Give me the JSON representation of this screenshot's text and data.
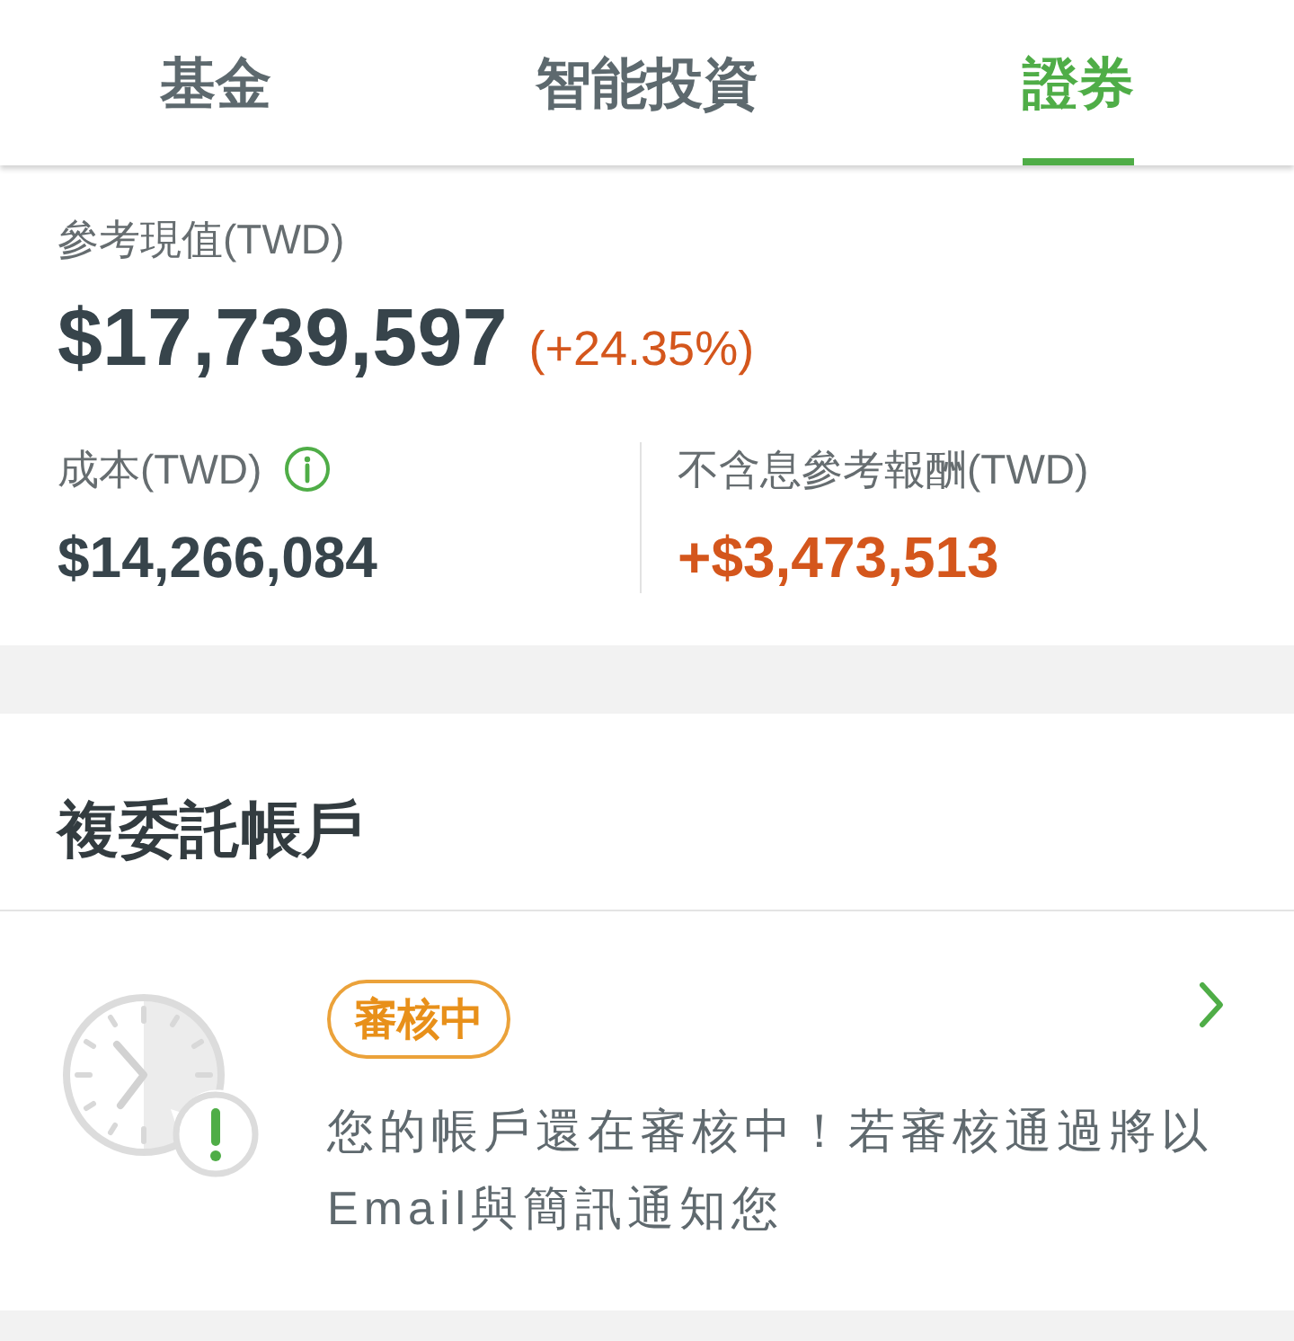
{
  "tabs": [
    {
      "label": "基金",
      "selected": false
    },
    {
      "label": "智能投資",
      "selected": false
    },
    {
      "label": "證券",
      "selected": true
    }
  ],
  "summary": {
    "value_label": "參考現值(TWD)",
    "value": "$17,739,597",
    "change": "(+24.35%)",
    "cost_label": "成本(TWD)",
    "cost": "$14,266,084",
    "return_label": "不含息參考報酬(TWD)",
    "return": "+$3,473,513"
  },
  "section": {
    "title": "複委託帳戶"
  },
  "account_card": {
    "status": "審核中",
    "message": "您的帳戶還在審核中！若審核通過將以Email與簡訊通知您"
  }
}
